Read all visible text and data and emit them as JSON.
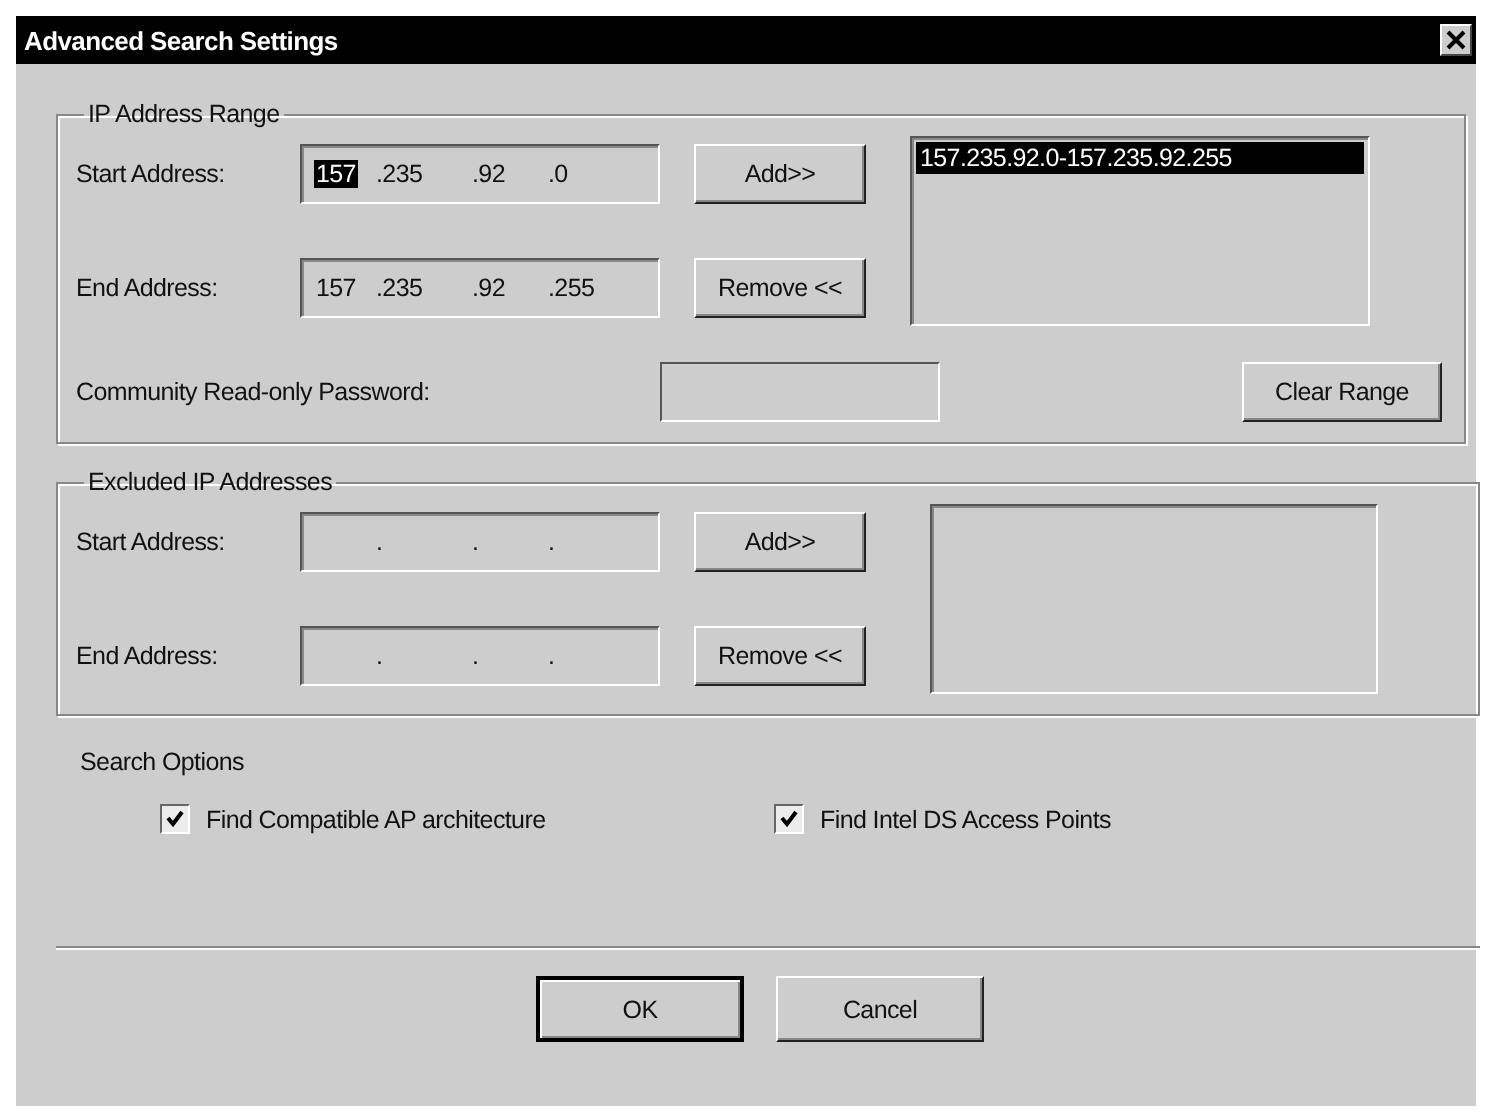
{
  "window": {
    "title": "Advanced Search Settings"
  },
  "ip_range": {
    "legend": "IP Address Range",
    "start": {
      "label": "Start Address:",
      "segments": [
        {
          "text": "157",
          "selected": true
        },
        {
          "text": ".235",
          "selected": false
        },
        {
          "text": ".92",
          "selected": false
        },
        {
          "text": ".0",
          "selected": false
        }
      ]
    },
    "end": {
      "label": "End Address:",
      "segments": [
        {
          "text": "157",
          "selected": false
        },
        {
          "text": ".235",
          "selected": false
        },
        {
          "text": ".92",
          "selected": false
        },
        {
          "text": ".255",
          "selected": false
        }
      ]
    },
    "add_button": "Add>>",
    "remove_button": "Remove <<",
    "list": [
      {
        "text": "157.235.92.0-157.235.92.255",
        "selected": true
      }
    ],
    "password_label": "Community Read-only Password:",
    "clear_button": "Clear Range"
  },
  "excluded": {
    "legend": "Excluded IP Addresses",
    "start": {
      "label": "Start Address:",
      "segments": [
        {
          "text": ".",
          "selected": false
        },
        {
          "text": ".",
          "selected": false
        },
        {
          "text": ".",
          "selected": false
        }
      ]
    },
    "end": {
      "label": "End Address:",
      "segments": [
        {
          "text": ".",
          "selected": false
        },
        {
          "text": ".",
          "selected": false
        },
        {
          "text": ".",
          "selected": false
        }
      ]
    },
    "add_button": "Add>>",
    "remove_button": "Remove <<"
  },
  "search_options": {
    "legend": "Search Options",
    "checkboxes": [
      {
        "label": "Find Compatible AP architecture",
        "checked": true
      },
      {
        "label": "Find Intel DS Access Points",
        "checked": true
      }
    ]
  },
  "buttons": [
    "OK",
    "Cancel"
  ]
}
